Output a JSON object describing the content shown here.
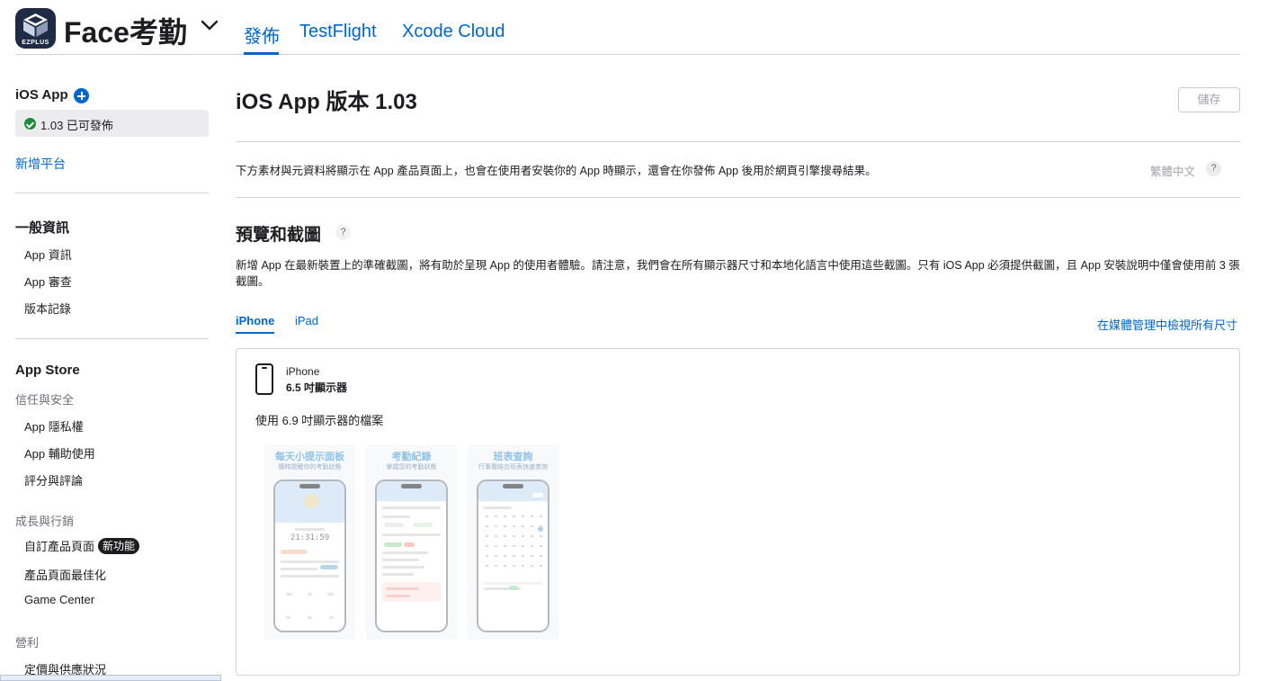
{
  "header": {
    "app_name": "Face考勤",
    "app_icon_label": "EZPLUS",
    "tabs": [
      {
        "label": "發佈",
        "active": true
      },
      {
        "label": "TestFlight",
        "active": false
      },
      {
        "label": "Xcode Cloud",
        "active": false
      }
    ],
    "accent_color": "#0066cc"
  },
  "sidebar": {
    "ios_header": "iOS App",
    "version_item": {
      "label": "1.03 已可發佈",
      "status_color": "#1d8b3c"
    },
    "add_platform": "新增平台",
    "general": {
      "title": "一般資訊",
      "items": [
        "App 資訊",
        "App 審查",
        "版本記錄"
      ]
    },
    "app_store": {
      "title": "App Store",
      "trust_group": "信任與安全",
      "trust_items": [
        "App 隱私權",
        "App 輔助使用",
        "評分與評論"
      ],
      "growth_group": "成長與行銷",
      "growth_items": [
        "自訂產品頁面",
        "產品頁面最佳化",
        "Game Center"
      ],
      "new_badge": "新功能",
      "monetization_group": "營利",
      "monetization_items": [
        "定價與供應狀況"
      ]
    }
  },
  "main": {
    "title": "iOS App 版本 1.03",
    "save_label": "儲存",
    "info_text": "下方素材與元資料將顯示在 App 產品頁面上，也會在使用者安裝你的 App 時顯示，還會在你發佈 App 後用於網頁引擎搜尋結果。",
    "locale": "繁體中文",
    "help_symbol": "?",
    "section_title": "預覽和截圖",
    "section_desc": "新增 App 在最新裝置上的準確截圖，將有助於呈現 App 的使用者體驗。請注意，我們會在所有顯示器尺寸和本地化語言中使用這些截圖。只有 iOS App 必須提供截圖，且 App 安裝說明中僅會使用前 3 張截圖。",
    "device_tabs": [
      {
        "label": "iPhone",
        "active": true
      },
      {
        "label": "iPad",
        "active": false
      }
    ],
    "media_link": "在媒體管理中檢視所有尺寸",
    "card": {
      "device": "iPhone",
      "size": "6.5 吋顯示器",
      "note": "使用 6.9 吋顯示器的檔案",
      "screenshots": [
        {
          "title": "每天小提示面板",
          "subtitle": "隨時提醒你的考勤狀態",
          "clock": "21:31:59"
        },
        {
          "title": "考勤紀錄",
          "subtitle": "掌握您的考勤狀態"
        },
        {
          "title": "班表查詢",
          "subtitle": "行事曆結合班表快速查詢"
        }
      ]
    }
  }
}
